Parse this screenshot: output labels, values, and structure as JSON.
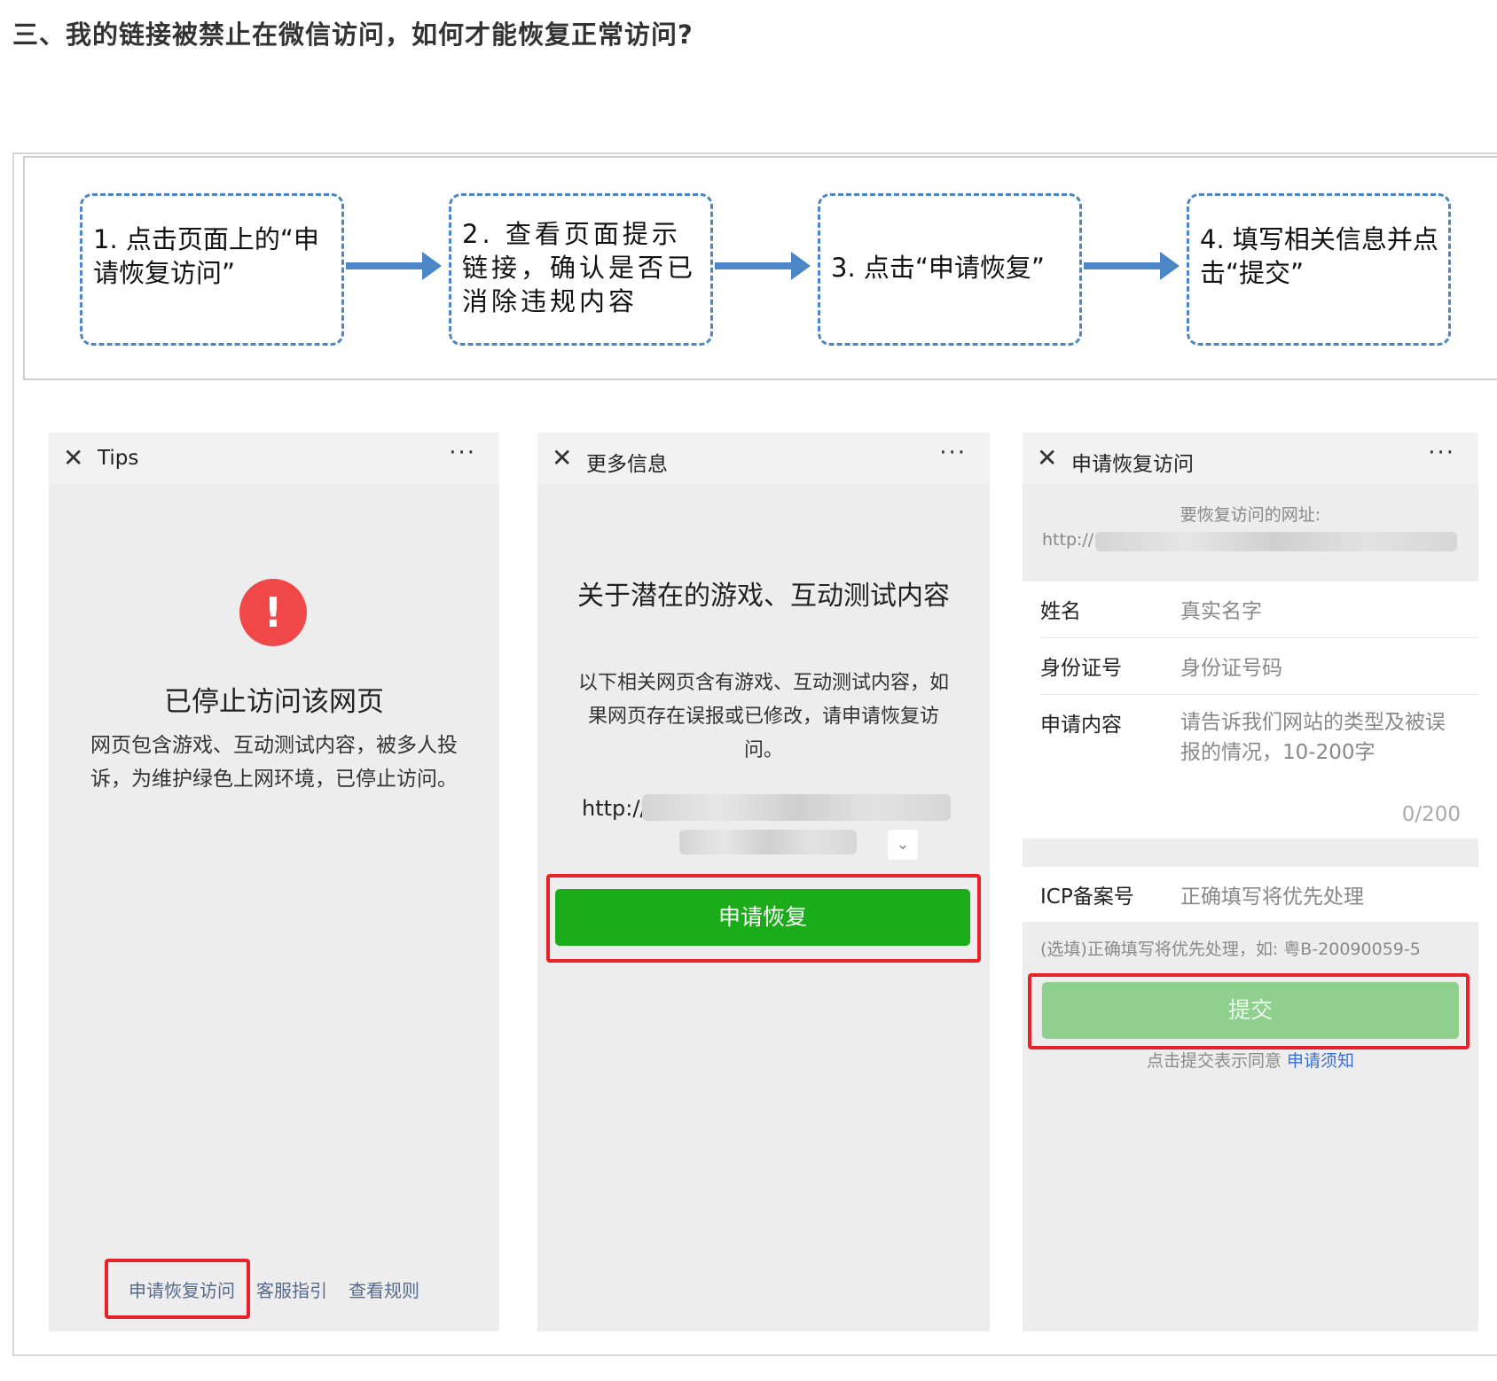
{
  "heading": "三、我的链接被禁止在微信访问，如何才能恢复正常访问?",
  "flow": {
    "steps": [
      "1. 点击页面上的“申请恢复访问”",
      "2. 查看页面提示链接，确认是否已消除违规内容",
      "3. 点击“申请恢复”",
      "4. 填写相关信息并点击“提交”"
    ],
    "accent_color": "#4a86c8"
  },
  "phone1": {
    "close_icon": "close-icon",
    "title": "Tips",
    "more": "···",
    "warning_glyph": "!",
    "headline": "已停止访问该网页",
    "description": "网页包含游戏、互动测试内容，被多人投诉，为维护绿色上网环境，已停止访问。",
    "links": [
      "申请恢复访问",
      "客服指引",
      "查看规则"
    ]
  },
  "phone2": {
    "title": "更多信息",
    "more": "···",
    "headline": "关于潜在的游戏、互动测试内容",
    "description": "以下相关网页含有游戏、互动测试内容，如果网页存在误报或已修改，请申请恢复访问。",
    "url_prefix": "http://",
    "button": "申请恢复",
    "button_color": "#1aad19"
  },
  "phone3": {
    "title": "申请恢复访问",
    "more": "···",
    "url_label": "要恢复访问的网址:",
    "url_prefix": "http://",
    "fields": [
      {
        "label": "姓名",
        "placeholder": "真实名字"
      },
      {
        "label": "身份证号",
        "placeholder": "身份证号码"
      },
      {
        "label": "申请内容",
        "placeholder": "请告诉我们网站的类型及被误报的情况，10-200字"
      }
    ],
    "counter": "0/200",
    "icp_label": "ICP备案号",
    "icp_placeholder": "正确填写将优先处理",
    "hint": "(选填)正确填写将优先处理，如: 粤B-20090059-5",
    "submit": "提交",
    "agree_text": "点击提交表示同意",
    "agree_link": "申请须知"
  },
  "highlight_color": "#e8222a"
}
